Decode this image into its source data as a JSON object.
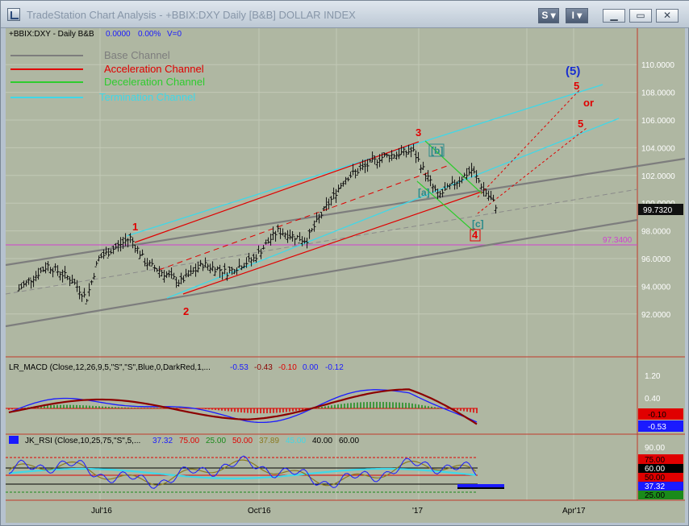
{
  "window": {
    "title": "TradeStation Chart Analysis - +BBIX:DXY Daily [B&B] DOLLAR INDEX",
    "s_button": "S ▾",
    "i_button": "I ▾",
    "minimize_icon": "minimize-icon",
    "restore_icon": "restore-icon",
    "close_icon": "close-icon"
  },
  "header": {
    "symbol_line": "+BBIX:DXY - Daily  B&B",
    "change_value": "0.0000",
    "change_percent": "0.00%",
    "volume": "V=0"
  },
  "legend": {
    "items": [
      {
        "label": "Base Channel",
        "color": "#7d7d7d"
      },
      {
        "label": "Acceleration Channel",
        "color": "#e00000"
      },
      {
        "label": "Deceleration Channel",
        "color": "#2ecc2e"
      },
      {
        "label": "Termination Channel",
        "color": "#3fd8e8"
      }
    ]
  },
  "wave_labels": {
    "w1": "1",
    "w2": "2",
    "w3": "3",
    "w4": "4",
    "w5": "5",
    "w5b": "5",
    "w5_big": "(5)",
    "or": "or",
    "a": "[a]",
    "b": "[b]",
    "c": "[c]"
  },
  "price_axis": {
    "ticks": [
      "110.0000",
      "108.0000",
      "106.0000",
      "104.0000",
      "102.0000",
      "100.0000",
      "98.0000",
      "96.0000",
      "94.0000",
      "92.0000"
    ],
    "current_price": "99.7320",
    "support_level": "97.3400"
  },
  "macd_panel": {
    "title": "LR_MACD (Close,12,26,9,5,\"S\",\"S\",Blue,0,DarkRed,1,...",
    "values": [
      "-0.53",
      "-0.43",
      "-0.10",
      "0.00",
      "-0.12"
    ],
    "ticks": [
      "1.20",
      "0.40"
    ],
    "badge_red": "-0.10",
    "badge_blue": "-0.53"
  },
  "rsi_panel": {
    "title": "JK_RSI (Close,10,25,75,\"S\",5,...",
    "values": [
      "37.32",
      "75.00",
      "25.00",
      "50.00",
      "37.89",
      "45.00",
      "40.00",
      "60.00"
    ],
    "ticks": [
      "90.00"
    ],
    "badges": [
      "75.00",
      "60.00",
      "50.00",
      "37.32",
      "25.00"
    ]
  },
  "time_axis": {
    "labels": [
      "Jul'16",
      "Oct'16",
      "'17",
      "Apr'17"
    ]
  },
  "colors": {
    "background": "#afb7a2",
    "grid": "#c0c8b5",
    "axis_border": "#c0392b"
  },
  "chart_data": {
    "type": "line",
    "title": "+BBIX:DXY Daily [B&B] DOLLAR INDEX",
    "xlabel": "",
    "ylabel": "",
    "ylim": [
      91,
      111
    ],
    "x_ticks": [
      "Jul'16",
      "Oct'16",
      "'17",
      "Apr'17"
    ],
    "series": [
      {
        "x": [
          "2016-05-15",
          "2016-06-01",
          "2016-06-15",
          "2016-06-24",
          "2016-07-01",
          "2016-07-20",
          "2016-07-29",
          "2016-08-18",
          "2016-09-01",
          "2016-09-15",
          "2016-10-01",
          "2016-10-15",
          "2016-11-01",
          "2016-11-09",
          "2016-11-24",
          "2016-12-15",
          "2017-01-03",
          "2017-01-18",
          "2017-02-07",
          "2017-02-15",
          "2017-02-22"
        ],
        "values": [
          93.8,
          95.5,
          94.5,
          93.1,
          96.0,
          97.5,
          95.7,
          94.3,
          95.6,
          95.0,
          96.0,
          98.0,
          97.3,
          99.0,
          101.8,
          103.3,
          103.8,
          100.5,
          102.4,
          100.8,
          99.7
        ]
      }
    ],
    "reference_lines": [
      {
        "value": 97.34
      }
    ]
  }
}
